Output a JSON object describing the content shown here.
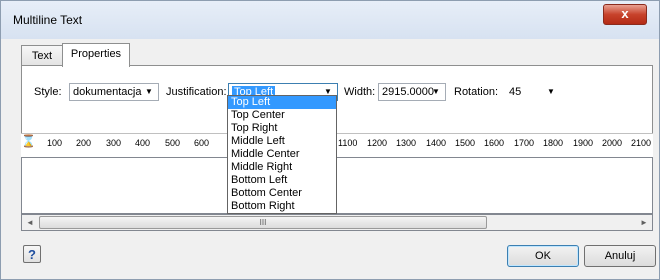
{
  "window": {
    "title": "Multiline Text",
    "close_label": "x"
  },
  "tabs": [
    {
      "label": "Text"
    },
    {
      "label": "Properties"
    }
  ],
  "properties": {
    "style_label": "Style:",
    "style_value": "dokumentacja",
    "justification_label": "Justification:",
    "justification_value": "Top Left",
    "width_label": "Width:",
    "width_value": "2915.0000",
    "rotation_label": "Rotation:",
    "rotation_value": "45"
  },
  "justification_options": [
    "Top Left",
    "Top Center",
    "Top Right",
    "Middle Left",
    "Middle Center",
    "Middle Right",
    "Bottom Left",
    "Bottom Center",
    "Bottom Right"
  ],
  "ruler": {
    "ticks": [
      "100",
      "200",
      "300",
      "400",
      "500",
      "600",
      "1100",
      "1200",
      "1300",
      "1400",
      "1500",
      "1600",
      "1700",
      "1800",
      "1900",
      "2000",
      "2100"
    ]
  },
  "scrollbar": {
    "left_arrow": "◄",
    "right_arrow": "►",
    "thumb_grip": "III"
  },
  "buttons": {
    "help": "?",
    "ok": "OK",
    "cancel": "Anuluj"
  },
  "icons": {
    "dropdown_arrow": "▼",
    "ruler_marker": "⌛"
  }
}
